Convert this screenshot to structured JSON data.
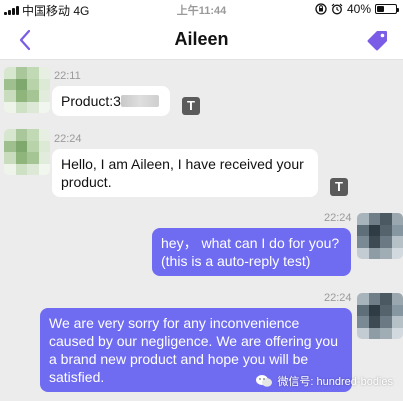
{
  "status_bar": {
    "carrier": "中国移动  4G",
    "time": "上午11:44",
    "battery_percent": "40%",
    "battery_level": 0.4
  },
  "header": {
    "title": "Aileen",
    "back_icon": "chevron-left-icon",
    "action_icon": "tag-icon",
    "accent_color": "#7a5ce6"
  },
  "messages": [
    {
      "direction": "in",
      "time": "22:11",
      "text": "Product:3"
    },
    {
      "direction": "in",
      "time": "22:24",
      "text": "Hello, I am Aileen, I have received your product."
    },
    {
      "direction": "out",
      "time": "22:24",
      "text": "hey， what can I do for you?\n(this is a auto-reply test)"
    },
    {
      "direction": "out",
      "time": "22:24",
      "text": "We are very sorry for any inconvenience caused by our negligence. We are offering you a brand new product and hope you will be satisfied."
    }
  ],
  "translate_button_label": "T",
  "watermark": {
    "text": "微信号: hundred-bodies"
  },
  "colors": {
    "outgoing_bubble": "#6f6cf1",
    "incoming_bubble": "#ffffff",
    "background": "#ececec"
  }
}
